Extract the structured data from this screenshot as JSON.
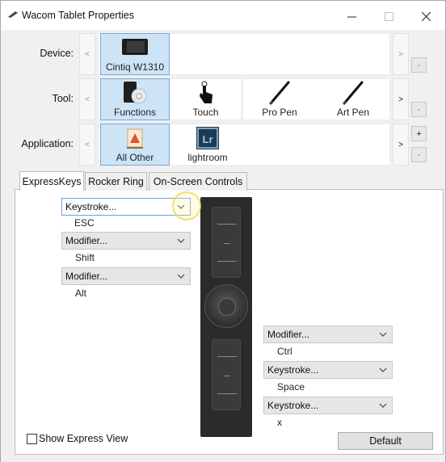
{
  "window": {
    "title": "Wacom Tablet Properties"
  },
  "device_row": {
    "label": "Device:",
    "tiles": [
      {
        "label": "Cintiq W1310",
        "icon": "tablet-device-icon",
        "selected": true
      }
    ]
  },
  "tool_row": {
    "label": "Tool:",
    "tiles": [
      {
        "label": "Functions",
        "icon": "functions-icon",
        "selected": true
      },
      {
        "label": "Touch",
        "icon": "touch-hand-icon",
        "selected": false
      },
      {
        "label": "Pro Pen",
        "icon": "pen-icon",
        "selected": false
      },
      {
        "label": "Art Pen",
        "icon": "pen-icon",
        "selected": false
      }
    ]
  },
  "application_row": {
    "label": "Application:",
    "tiles": [
      {
        "label": "All Other",
        "icon": "all-apps-icon",
        "selected": true
      },
      {
        "label": "lightroom",
        "icon": "lightroom-icon",
        "icon_text": "Lr",
        "selected": false
      }
    ]
  },
  "buttons": {
    "prev": "<",
    "next": ">",
    "add": "+",
    "remove": "-",
    "default": "Default"
  },
  "tabs": [
    {
      "label": "ExpressKeys",
      "active": true
    },
    {
      "label": "Rocker Ring",
      "active": false
    },
    {
      "label": "On-Screen Controls",
      "active": false
    }
  ],
  "left_keys": [
    {
      "action": "Keystroke...",
      "value": "ESC"
    },
    {
      "action": "Modifier...",
      "value": "Shift"
    },
    {
      "action": "Modifier...",
      "value": "Alt"
    }
  ],
  "right_keys": [
    {
      "action": "Modifier...",
      "value": "Ctrl"
    },
    {
      "action": "Keystroke...",
      "value": "Space"
    },
    {
      "action": "Keystroke...",
      "value": "x"
    }
  ],
  "show_express_view": {
    "label": "Show Express View",
    "checked": false
  },
  "colors": {
    "selection": "#cde4f7",
    "selection_border": "#7aa7d6",
    "tablet_body": "#2b2b2b",
    "panel_bg": "#f0f0f0"
  }
}
